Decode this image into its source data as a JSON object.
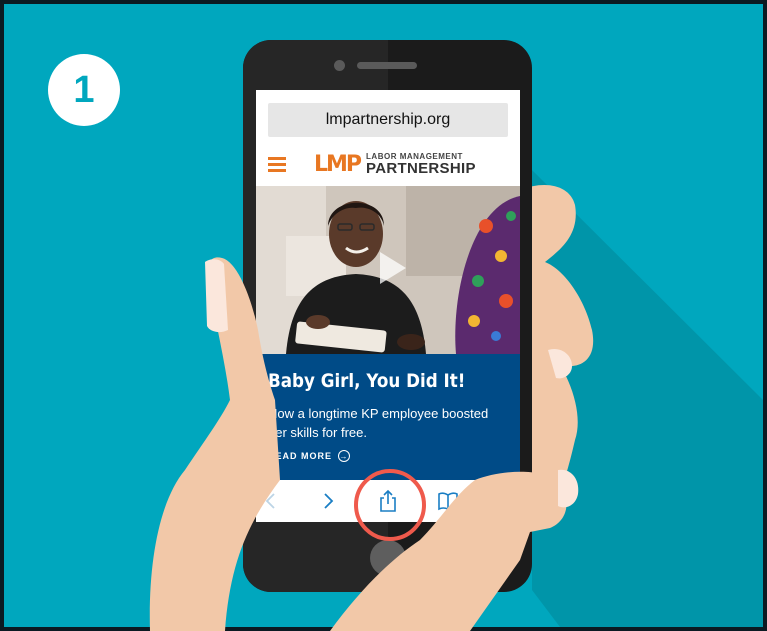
{
  "step": {
    "number": "1"
  },
  "browser": {
    "url": "lmpartnership.org"
  },
  "site": {
    "logo_mark": "LMP",
    "logo_line1": "LABOR MANAGEMENT",
    "logo_line2": "PARTNERSHIP"
  },
  "article": {
    "title": "Baby Girl, You Did It!",
    "subtitle": "How a longtime KP employee boosted her skills for free.",
    "cta": "READ MORE"
  },
  "toolbar": {
    "items": [
      "back-icon",
      "forward-icon",
      "share-icon",
      "bookmarks-icon",
      "tabs-icon"
    ],
    "highlighted": "share-icon"
  },
  "colors": {
    "background": "#00a7be",
    "accent": "#e87722",
    "card": "#004b87",
    "highlight_ring": "#ef5a4c",
    "toolbar_icons": "#1a7ec4"
  }
}
